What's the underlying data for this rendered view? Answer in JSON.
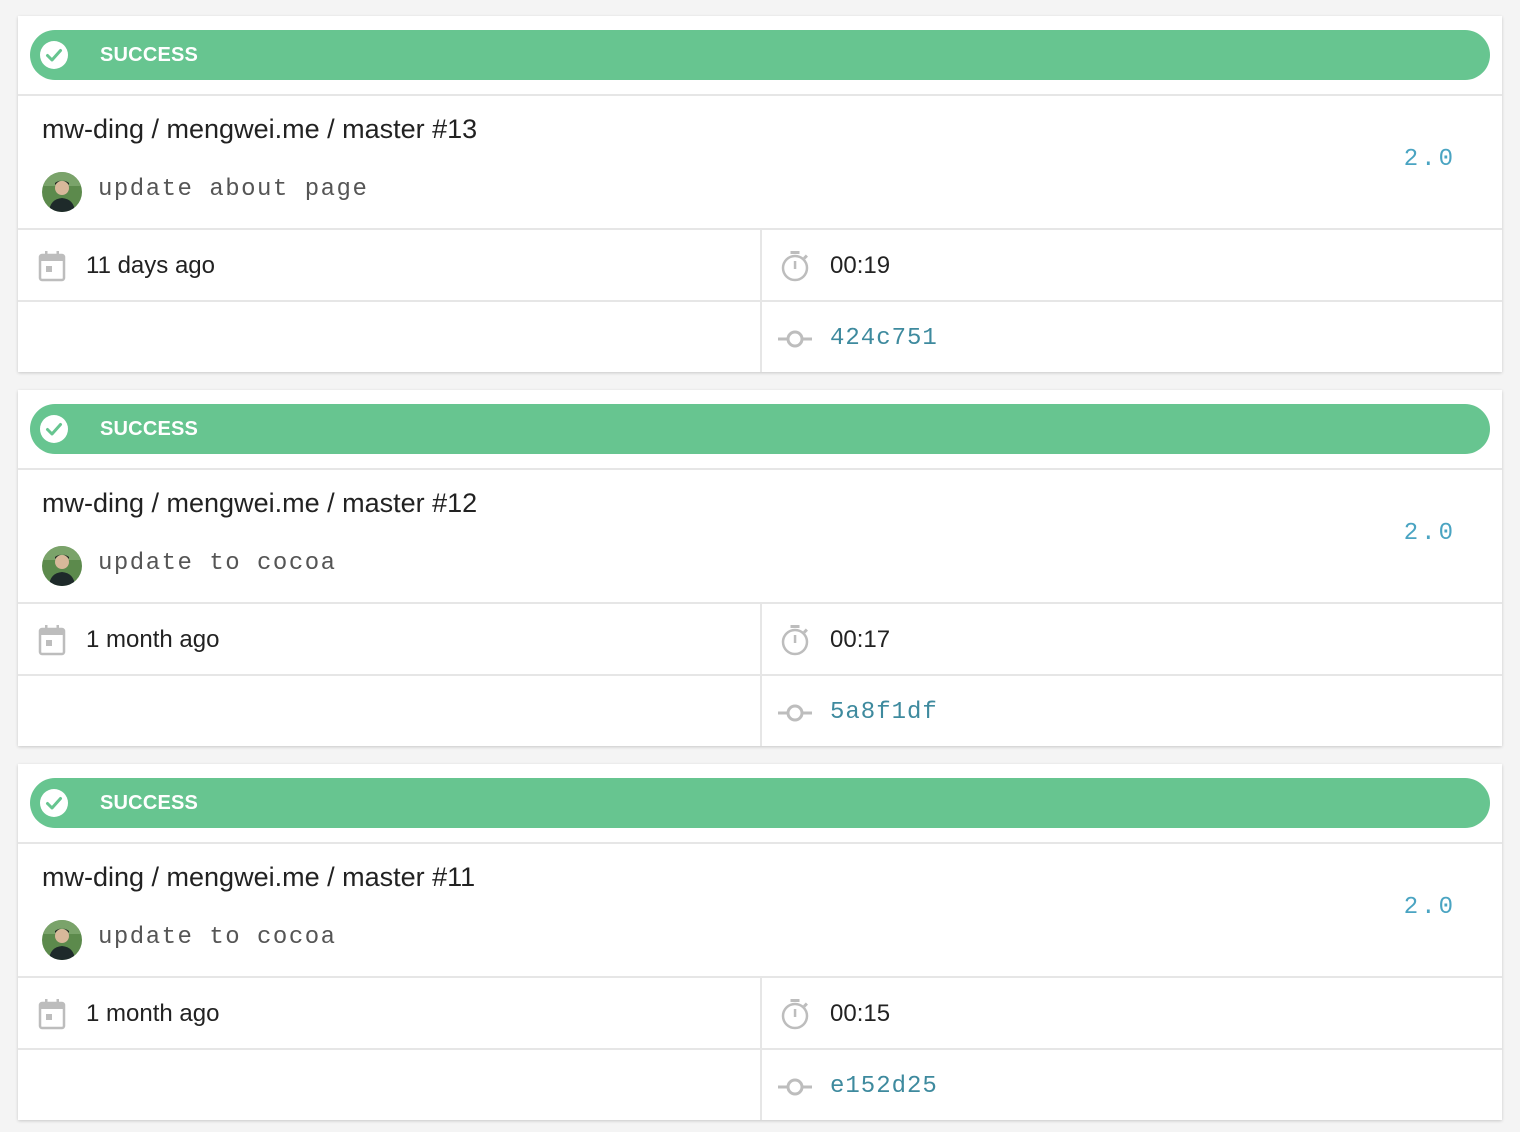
{
  "colors": {
    "success": "#67c590",
    "version": "#4aa4c2",
    "commit": "#3e8a9e",
    "icon": "#bdbdbd",
    "page_background": "#f4f4f4"
  },
  "builds": [
    {
      "status": "SUCCESS",
      "status_icon": "check-circle-icon",
      "title": "mw-ding / mengwei.me / master #13",
      "message": "update about page",
      "version": "2.0",
      "created": "11 days ago",
      "duration": "00:19",
      "commit": "424c751"
    },
    {
      "status": "SUCCESS",
      "status_icon": "check-circle-icon",
      "title": "mw-ding / mengwei.me / master #12",
      "message": "update to cocoa",
      "version": "2.0",
      "created": "1 month ago",
      "duration": "00:17",
      "commit": "5a8f1df"
    },
    {
      "status": "SUCCESS",
      "status_icon": "check-circle-icon",
      "title": "mw-ding / mengwei.me / master #11",
      "message": "update to cocoa",
      "version": "2.0",
      "created": "1 month ago",
      "duration": "00:15",
      "commit": "e152d25"
    }
  ]
}
